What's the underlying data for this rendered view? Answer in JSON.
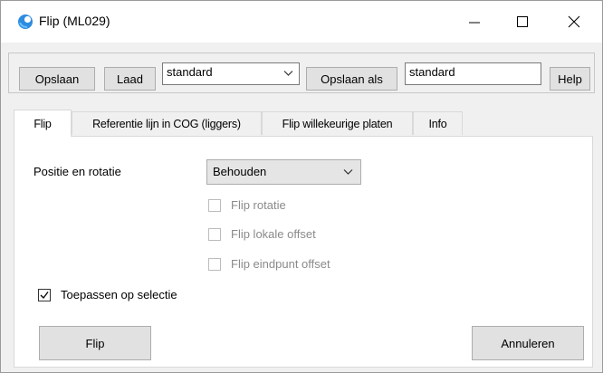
{
  "window": {
    "title": "Flip (ML029)",
    "icon": "app-logo-icon"
  },
  "toolbar": {
    "save_label": "Opslaan",
    "load_label": "Laad",
    "preset_value": "standard",
    "save_as_label": "Opslaan als",
    "save_as_value": "standard",
    "help_label": "Help"
  },
  "tabs": [
    {
      "label": "Flip",
      "active": true
    },
    {
      "label": "Referentie lijn in COG (liggers)",
      "active": false
    },
    {
      "label": "Flip willekeurige platen",
      "active": false
    },
    {
      "label": "Info",
      "active": false
    }
  ],
  "flip_tab": {
    "position_label": "Positie en rotatie",
    "position_value": "Behouden",
    "options": [
      {
        "label": "Flip rotatie",
        "checked": false,
        "enabled": false
      },
      {
        "label": "Flip lokale offset",
        "checked": false,
        "enabled": false
      },
      {
        "label": "Flip eindpunt offset",
        "checked": false,
        "enabled": false
      }
    ],
    "apply_to_selection_label": "Toepassen op selectie",
    "apply_to_selection_checked": true
  },
  "footer": {
    "flip_label": "Flip",
    "cancel_label": "Annuleren"
  },
  "colors": {
    "accent": "#1e90ff",
    "window_bg": "#f0f0f0",
    "button_bg": "#e1e1e1"
  }
}
